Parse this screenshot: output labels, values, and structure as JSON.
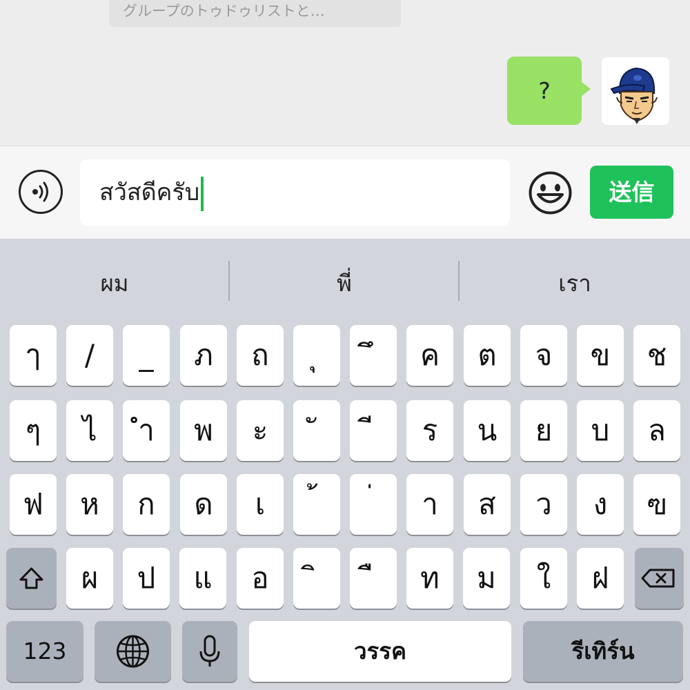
{
  "chat": {
    "system_note": "グループのトゥドゥリストと…",
    "message": "?",
    "avatar_icon": "user-avatar-cap"
  },
  "input": {
    "voice_icon": "voice-message-icon",
    "text_value": "สวัสดีครับ",
    "emoji_icon": "smiley-icon",
    "send_label": "送信"
  },
  "keyboard": {
    "suggestions": [
      "ผม",
      "พี่",
      "เรา"
    ],
    "row1": [
      "ๅ",
      "/",
      "_",
      "ภ",
      "ถ",
      "ุ",
      "ึ",
      "ค",
      "ต",
      "จ",
      "ข",
      "ช"
    ],
    "row2": [
      "ๆ",
      "ไ",
      "ำ",
      "พ",
      "ะ",
      "ั",
      "ี",
      "ร",
      "น",
      "ย",
      "บ",
      "ล"
    ],
    "row3": [
      "ฟ",
      "ห",
      "ก",
      "ด",
      "เ",
      "้",
      "่",
      "า",
      "ส",
      "ว",
      "ง",
      "ฃ"
    ],
    "row4": [
      "ผ",
      "ป",
      "แ",
      "อ",
      "ิ",
      "ื",
      "ท",
      "ม",
      "ใ",
      "ฝ"
    ],
    "numbers_label": "123",
    "space_label": "วรรค",
    "return_label": "รีเทิร์น",
    "shift_icon": "shift-icon",
    "backspace_icon": "backspace-icon",
    "globe_icon": "globe-icon",
    "mic_icon": "microphone-icon"
  }
}
